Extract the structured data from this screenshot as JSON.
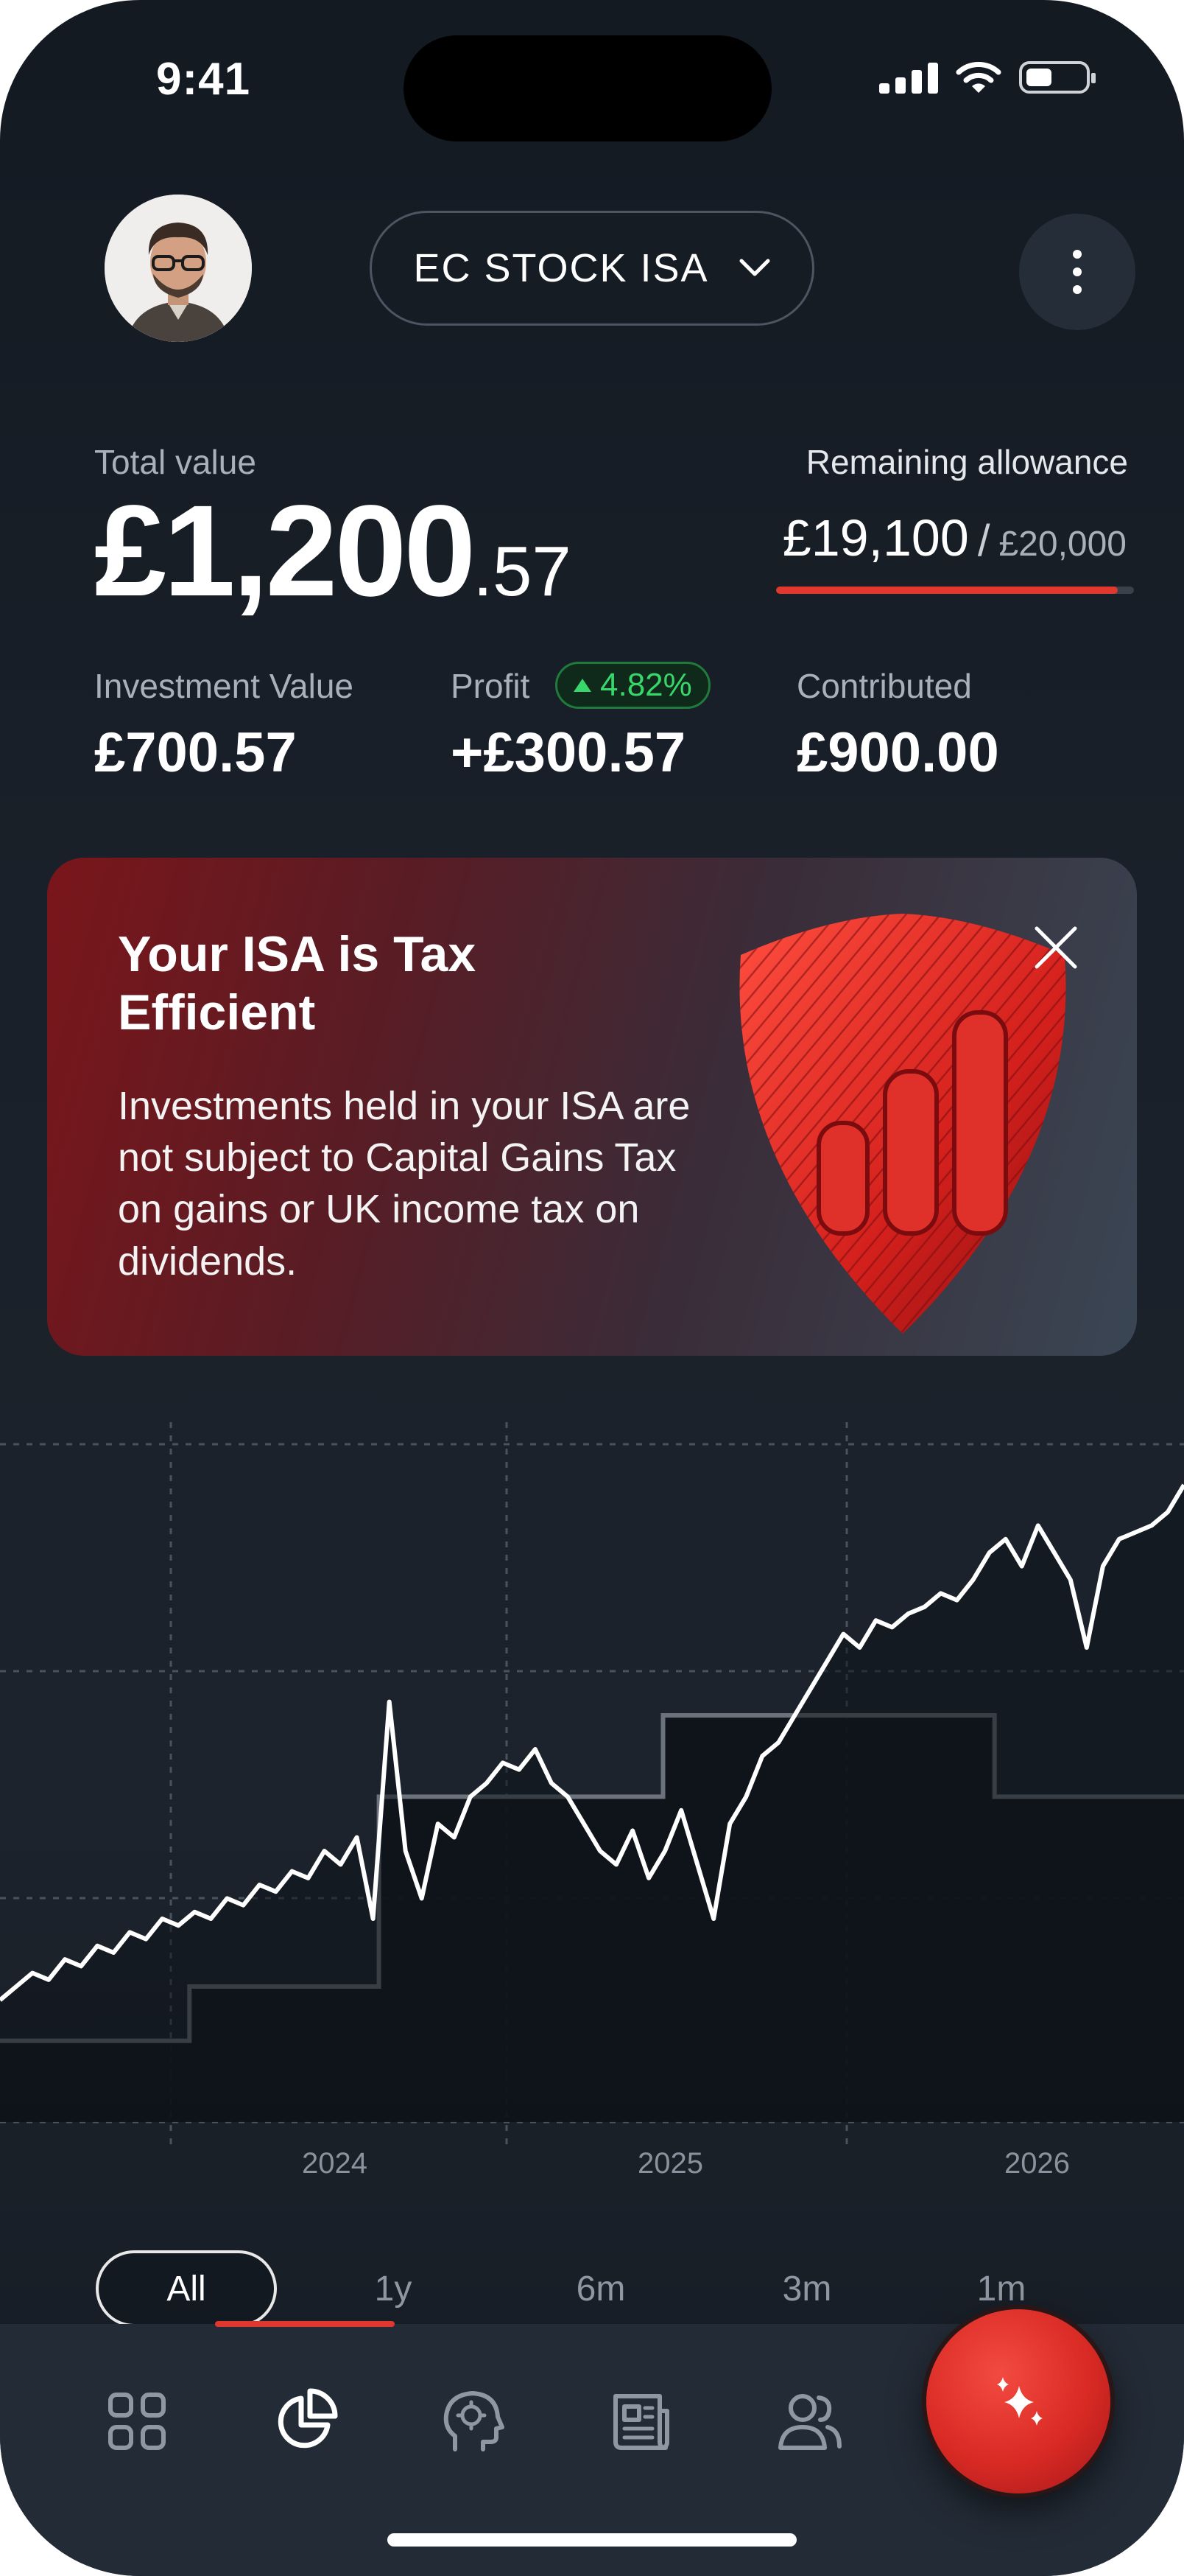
{
  "status_bar": {
    "time": "9:41"
  },
  "header": {
    "account_name": "EC STOCK ISA"
  },
  "summary": {
    "total_label": "Total value",
    "total_main": "£1,200",
    "total_cents": ".57",
    "remaining_label": "Remaining allowance",
    "remaining_value": "£19,100",
    "remaining_separator": "/",
    "allowance_total": "£20,000",
    "allowance_used_fraction": 0.955,
    "investment_label": "Investment Value",
    "investment_value": "£700.57",
    "profit_label": "Profit",
    "profit_change": "4.82%",
    "profit_value": "+£300.57",
    "contributed_label": "Contributed",
    "contributed_value": "£900.00"
  },
  "promo": {
    "title": "Your ISA is Tax Efficient",
    "body": "Investments held in your ISA are not subject to Capital Gains Tax on gains or UK income tax on dividends."
  },
  "chart_data": {
    "type": "line",
    "x_tick_labels": [
      "2024",
      "2025",
      "2026"
    ],
    "grid": true,
    "series": [
      {
        "values": [
          0.18,
          0.2,
          0.22,
          0.21,
          0.24,
          0.23,
          0.26,
          0.25,
          0.28,
          0.27,
          0.3,
          0.29,
          0.31,
          0.3,
          0.33,
          0.32,
          0.35,
          0.34,
          0.37,
          0.36,
          0.4,
          0.38,
          0.42,
          0.3,
          0.62,
          0.4,
          0.33,
          0.44,
          0.42,
          0.48,
          0.5,
          0.53,
          0.52,
          0.55,
          0.5,
          0.48,
          0.44,
          0.4,
          0.38,
          0.43,
          0.36,
          0.4,
          0.46,
          0.38,
          0.3,
          0.44,
          0.48,
          0.54,
          0.56,
          0.6,
          0.64,
          0.68,
          0.72,
          0.7,
          0.74,
          0.73,
          0.75,
          0.76,
          0.78,
          0.77,
          0.8,
          0.84,
          0.86,
          0.82,
          0.88,
          0.84,
          0.8,
          0.7,
          0.82,
          0.86,
          0.87,
          0.88,
          0.9,
          0.94
        ]
      },
      {
        "values": [
          0.12,
          0.12,
          0.12,
          0.12,
          0.2,
          0.2,
          0.2,
          0.2,
          0.48,
          0.48,
          0.48,
          0.48,
          0.48,
          0.48,
          0.6,
          0.6,
          0.6,
          0.6,
          0.6,
          0.6,
          0.6,
          0.48,
          0.48,
          0.48,
          0.48,
          0.48
        ]
      }
    ],
    "range_options": [
      "All",
      "1y",
      "6m",
      "3m",
      "1m"
    ],
    "selected_range": "All"
  },
  "nav": {
    "items": [
      "grid-icon",
      "pie-chart-icon",
      "brain-icon",
      "news-icon",
      "people-icon"
    ],
    "active": "pie-chart-icon",
    "fab_icon": "sparkles-icon"
  },
  "colors": {
    "accent": "#e0372f",
    "positive": "#38d66b",
    "background": "#1a2029"
  }
}
